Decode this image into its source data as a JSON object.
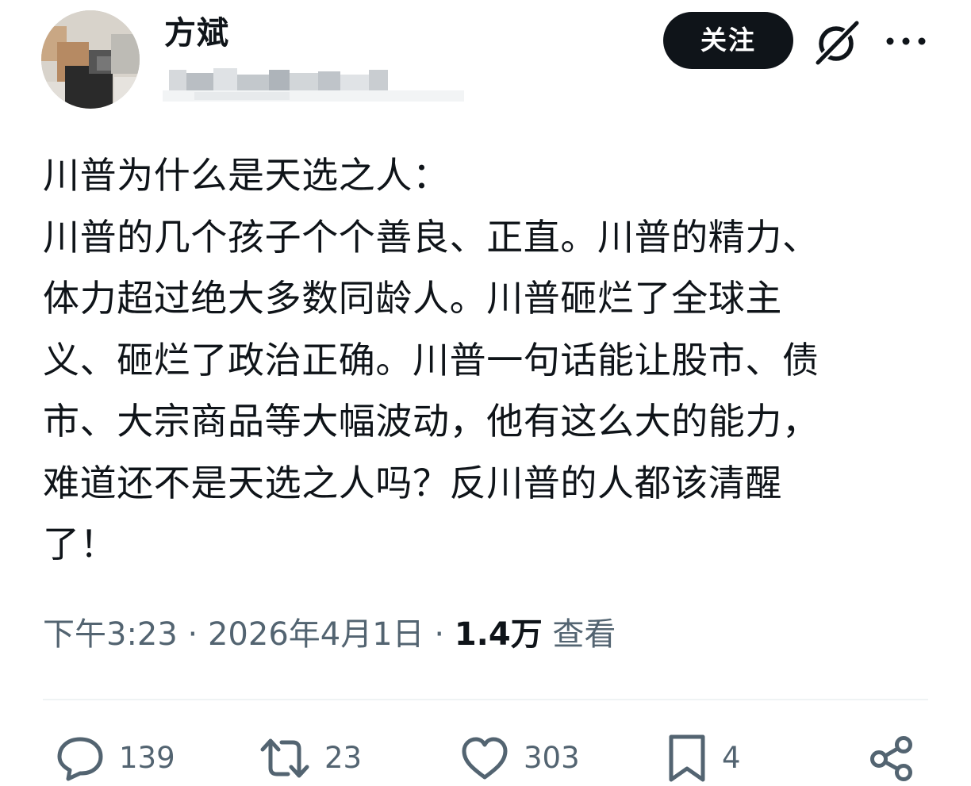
{
  "author": {
    "name": "方斌"
  },
  "header": {
    "follow_label": "关注",
    "grok_icon": "grok-slash-icon",
    "more_icon": "more-horizontal-icon"
  },
  "post": {
    "lines": [
      "川普为什么是天选之人：",
      "川普的几个孩子个个善良、正直。川普的精力、",
      "体力超过绝大多数同龄人。川普砸烂了全球主",
      "义、砸烂了政治正确。川普一句话能让股市、债",
      "市、大宗商品等大幅波动，他有这么大的能力，",
      "难道还不是天选之人吗？反川普的人都该清醒",
      "了！"
    ]
  },
  "meta": {
    "time": "下午3:23",
    "separator": "·",
    "date": "2026年4月1日",
    "views_count": "1.4万",
    "views_label": "查看"
  },
  "actions": {
    "replies": "139",
    "reposts": "23",
    "likes": "303",
    "bookmarks": "4"
  },
  "colors": {
    "text_primary": "#0f1419",
    "text_secondary": "#536471",
    "follow_bg": "#0f1419",
    "follow_text": "#ffffff",
    "divider": "#eff3f4"
  }
}
